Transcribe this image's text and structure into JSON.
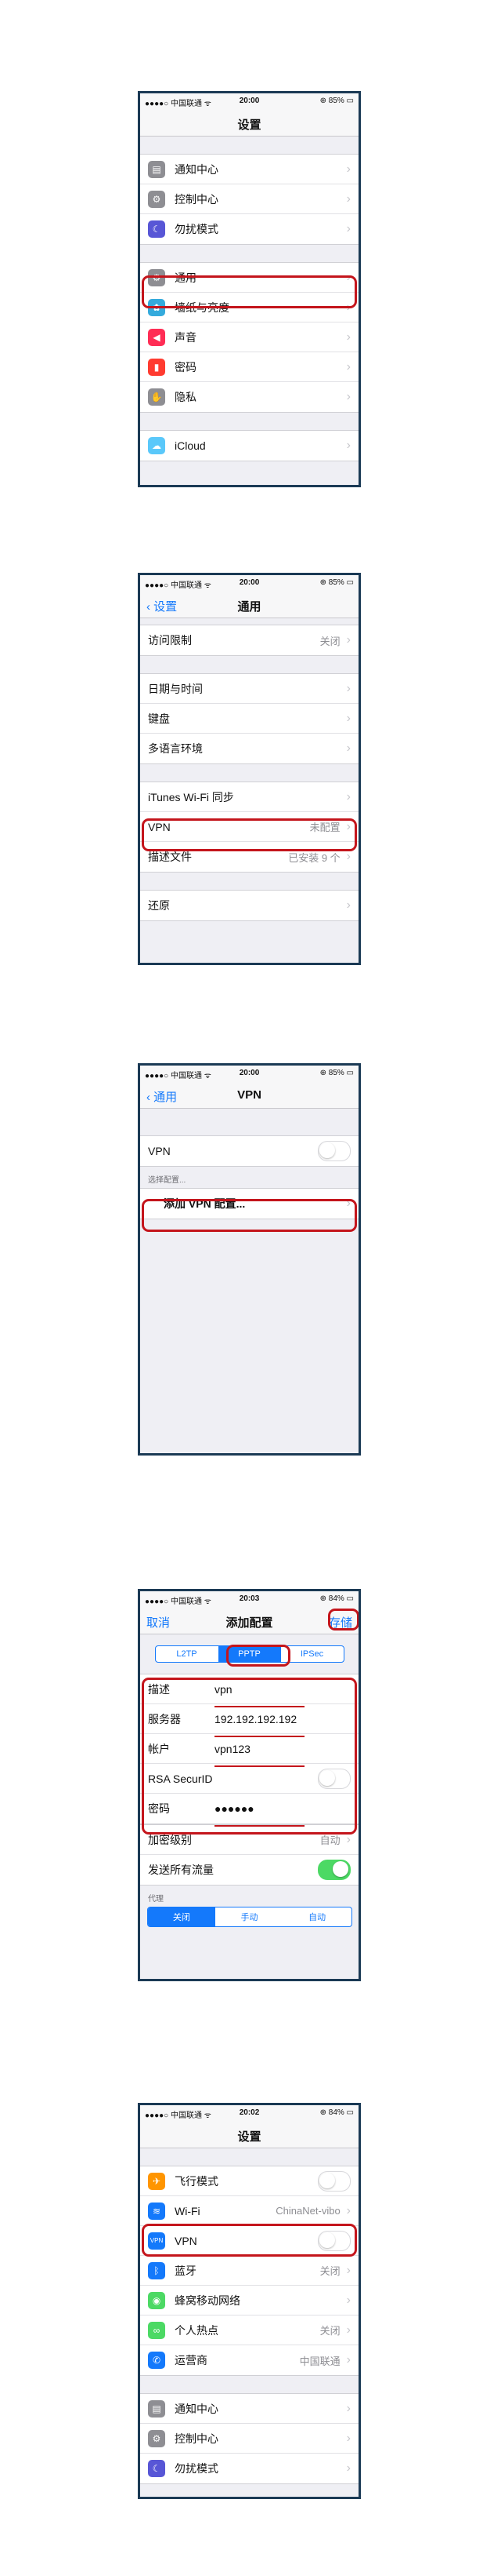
{
  "status": {
    "carrier": "●●●●○ 中国联通 ᯤ",
    "battery85": "⊕ 85% ▭",
    "battery84": "⊕ 84% ▭",
    "time1": "20:00",
    "time2": "20:00",
    "time3": "20:00",
    "time4": "20:03",
    "time5": "20:02"
  },
  "s1": {
    "title": "设置",
    "g1": [
      "通知中心",
      "控制中心",
      "勿扰模式"
    ],
    "g2": [
      "通用",
      "墙纸与亮度",
      "声音",
      "密码",
      "隐私"
    ],
    "icloud": "iCloud"
  },
  "s2": {
    "back": "设置",
    "title": "通用",
    "restrict": "访问限制",
    "restrict_val": "关闭",
    "date": "日期与时间",
    "keyboard": "键盘",
    "lang": "多语言环境",
    "itunes": "iTunes Wi-Fi 同步",
    "vpn": "VPN",
    "vpn_val": "未配置",
    "profile": "描述文件",
    "profile_val": "已安装 9 个",
    "reset": "还原"
  },
  "s3": {
    "back": "通用",
    "title": "VPN",
    "vpn": "VPN",
    "choose": "选择配置...",
    "add": "添加 VPN 配置..."
  },
  "s4": {
    "cancel": "取消",
    "title": "添加配置",
    "save": "存储",
    "seg": [
      "L2TP",
      "PPTP",
      "IPSec"
    ],
    "fields": [
      {
        "k": "描述",
        "v": "vpn"
      },
      {
        "k": "服务器",
        "v": "192.192.192.192"
      },
      {
        "k": "帐户",
        "v": "vpn123"
      },
      {
        "k": "RSA SecurID",
        "v": ""
      },
      {
        "k": "密码",
        "v": "●●●●●●"
      }
    ],
    "enc": "加密级别",
    "enc_val": "自动",
    "sendall": "发送所有流量",
    "proxy": "代理",
    "proxy_seg": [
      "关闭",
      "手动",
      "自动"
    ]
  },
  "s5": {
    "title": "设置",
    "airplane": "飞行模式",
    "wifi": "Wi-Fi",
    "wifi_val": "ChinaNet-vibo",
    "vpn": "VPN",
    "bt": "蓝牙",
    "bt_val": "关闭",
    "cell": "蜂窝移动网络",
    "hotspot": "个人热点",
    "hotspot_val": "关闭",
    "carrier": "运营商",
    "carrier_val": "中国联通",
    "g2": [
      "通知中心",
      "控制中心",
      "勿扰模式"
    ]
  },
  "colors": {
    "accent": "#1479fb",
    "highlight": "#c4151c"
  }
}
